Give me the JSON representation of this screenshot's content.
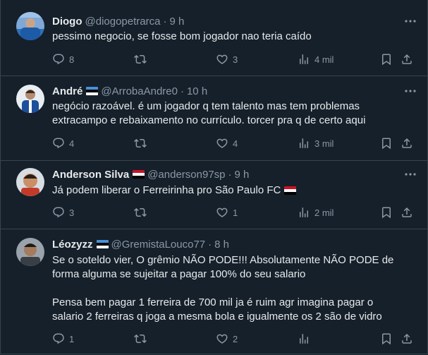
{
  "tweets": [
    {
      "name": "Diogo",
      "handle": "@diogopetrarca",
      "time": "9 h",
      "text": [
        "pessimo negocio, se fosse bom jogador nao teria caído"
      ],
      "replies": "8",
      "retweets": "",
      "likes": "3",
      "views": "4 mil",
      "flag": ""
    },
    {
      "name": "André",
      "handle": "@ArrobaAndre0",
      "time": "10 h",
      "text": [
        "negócio razoável. é um jogador q tem talento mas tem problemas extracampo e rebaixamento no currículo. torcer pra q de certo aqui"
      ],
      "replies": "4",
      "retweets": "",
      "likes": "4",
      "views": "3 mil",
      "flag": "estonia-flag"
    },
    {
      "name": "Anderson Silva",
      "handle": "@anderson97sp",
      "time": "9 h",
      "text": [
        "Já podem liberar o Ferreirinha pro São Paulo FC"
      ],
      "replies": "3",
      "retweets": "",
      "likes": "1",
      "views": "2 mil",
      "flag": "egypt-flag"
    },
    {
      "name": "Léozyzz",
      "handle": "@GremistaLouco77",
      "time": "8 h",
      "text": [
        "Se o soteldo vier, O grêmio NÃO PODE!!! Absolutamente NÃO PODE de forma alguma se sujeitar a pagar 100% do seu salario",
        "Pensa bem pagar 1 ferreira de 700 mil ja é ruim agr imagina pagar o salario 2 ferreiras q joga a mesma bola e igualmente os 2 são de vidro"
      ],
      "replies": "1",
      "retweets": "",
      "likes": "2",
      "views": "",
      "flag": "estonia-flag"
    }
  ],
  "colors": {
    "background": "#15202b",
    "text": "#e7e9ea",
    "secondary": "#8b98a5",
    "border": "#38444d"
  },
  "icons": [
    "more-icon",
    "reply-icon",
    "retweet-icon",
    "like-icon",
    "views-icon",
    "bookmark-icon",
    "share-icon",
    "estonia-flag",
    "egypt-flag"
  ]
}
